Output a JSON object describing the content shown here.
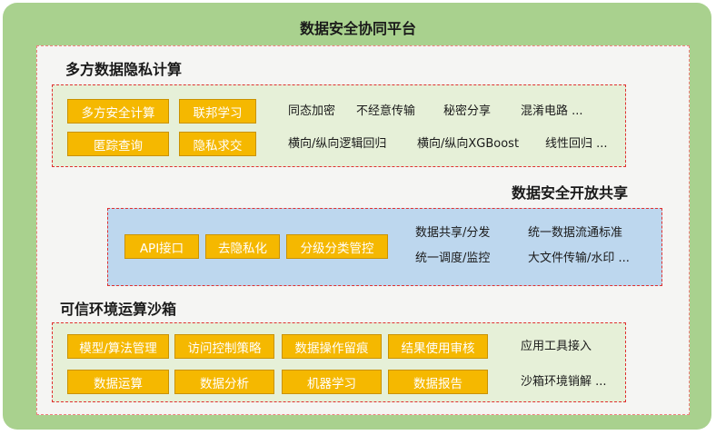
{
  "title": "数据安全协同平台",
  "privacy": {
    "title": "多方数据隐私计算",
    "chips": [
      "多方安全计算",
      "联邦学习",
      "匿踪查询",
      "隐私求交"
    ],
    "labels": [
      "同态加密",
      "不经意传输",
      "秘密分享",
      "混淆电路 ...",
      "横向/纵向逻辑回归",
      "横向/纵向XGBoost",
      "线性回归 ..."
    ]
  },
  "sharing": {
    "title": "数据安全开放共享",
    "chips": [
      "API接口",
      "去隐私化",
      "分级分类管控"
    ],
    "labels": [
      "数据共享/分发",
      "统一数据流通标准",
      "统一调度/监控",
      "大文件传输/水印 ..."
    ]
  },
  "sandbox": {
    "title": "可信环境运算沙箱",
    "chips": [
      "模型/算法管理",
      "访问控制策略",
      "数据操作留痕",
      "结果使用审核",
      "数据运算",
      "数据分析",
      "机器学习",
      "数据报告"
    ],
    "labels": [
      "应用工具接入",
      "沙箱环境销解 ..."
    ]
  },
  "colors": {
    "outer": "#a9d18e",
    "chip": "#f5b800",
    "dash": "#e03030",
    "blue": "#bdd7ee",
    "green": "#e6f0d8"
  }
}
